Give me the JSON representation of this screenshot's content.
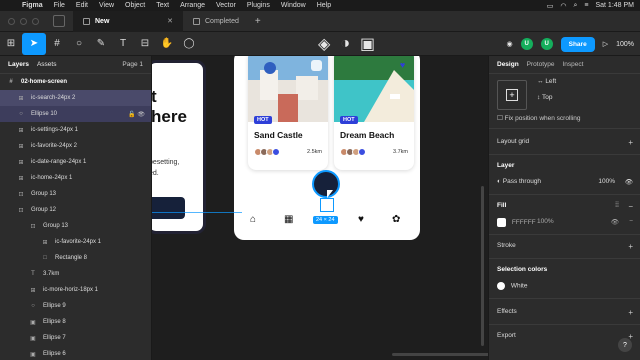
{
  "menubar": {
    "app": "Figma",
    "items": [
      "File",
      "Edit",
      "View",
      "Object",
      "Text",
      "Arrange",
      "Vector",
      "Plugins",
      "Window",
      "Help"
    ],
    "clock": "Sat 1:48 PM"
  },
  "tabs": [
    {
      "label": "New"
    },
    {
      "label": "Completed"
    }
  ],
  "toolbar": {
    "share_label": "Share",
    "zoom": "100%",
    "avatars": [
      "U",
      "U"
    ]
  },
  "layers_panel": {
    "tab_layers": "Layers",
    "tab_assets": "Assets",
    "page": "Page 1",
    "items": [
      {
        "icon": "#",
        "label": "02-home-screen"
      },
      {
        "icon": "⊞",
        "label": "ic-search-24px 2"
      },
      {
        "icon": "○",
        "label": "Ellipse 10"
      },
      {
        "icon": "⊞",
        "label": "ic-settings-24px 1"
      },
      {
        "icon": "⊞",
        "label": "ic-favorite-24px 2"
      },
      {
        "icon": "⊞",
        "label": "ic-date-range-24px 1"
      },
      {
        "icon": "⊞",
        "label": "ic-home-24px 1"
      },
      {
        "icon": "⊡",
        "label": "Group 13"
      },
      {
        "icon": "⊡",
        "label": "Group 12"
      },
      {
        "icon": "⊡",
        "label": "Group 13"
      },
      {
        "icon": "⊞",
        "label": "ic-favorite-24px 1"
      },
      {
        "icon": "□",
        "label": "Rectangle 8"
      },
      {
        "icon": "T",
        "label": "3.7km"
      },
      {
        "icon": "⊞",
        "label": "ic-more-horiz-18px 1"
      },
      {
        "icon": "○",
        "label": "Ellipse 9"
      },
      {
        "icon": "▣",
        "label": "Ellipse 8"
      },
      {
        "icon": "▣",
        "label": "Ellipse 7"
      },
      {
        "icon": "▣",
        "label": "Ellipse 6"
      }
    ]
  },
  "canvas": {
    "frame1_big": "t\nhere",
    "frame1_text": "besetting,\ned.",
    "cards": [
      {
        "badge": "HOT",
        "name": "Sand Castle",
        "distance": "2.5km"
      },
      {
        "badge": "HOT",
        "name": "Dream Beach",
        "distance": "3.7km"
      }
    ],
    "size_label": "24 × 24"
  },
  "design_panel": {
    "tabs": [
      "Design",
      "Prototype",
      "Inspect"
    ],
    "align_h": "Left",
    "align_v": "Top",
    "fix_scroll": "Fix position when scrolling",
    "layout_grid": "Layout grid",
    "layer": "Layer",
    "blend": "Pass through",
    "layer_opacity": "100%",
    "fill": "Fill",
    "fill_hex": "FFFFFF",
    "fill_opacity": "100%",
    "stroke": "Stroke",
    "selection_colors": "Selection colors",
    "sel_color": "White",
    "effects": "Effects",
    "export": "Export"
  }
}
